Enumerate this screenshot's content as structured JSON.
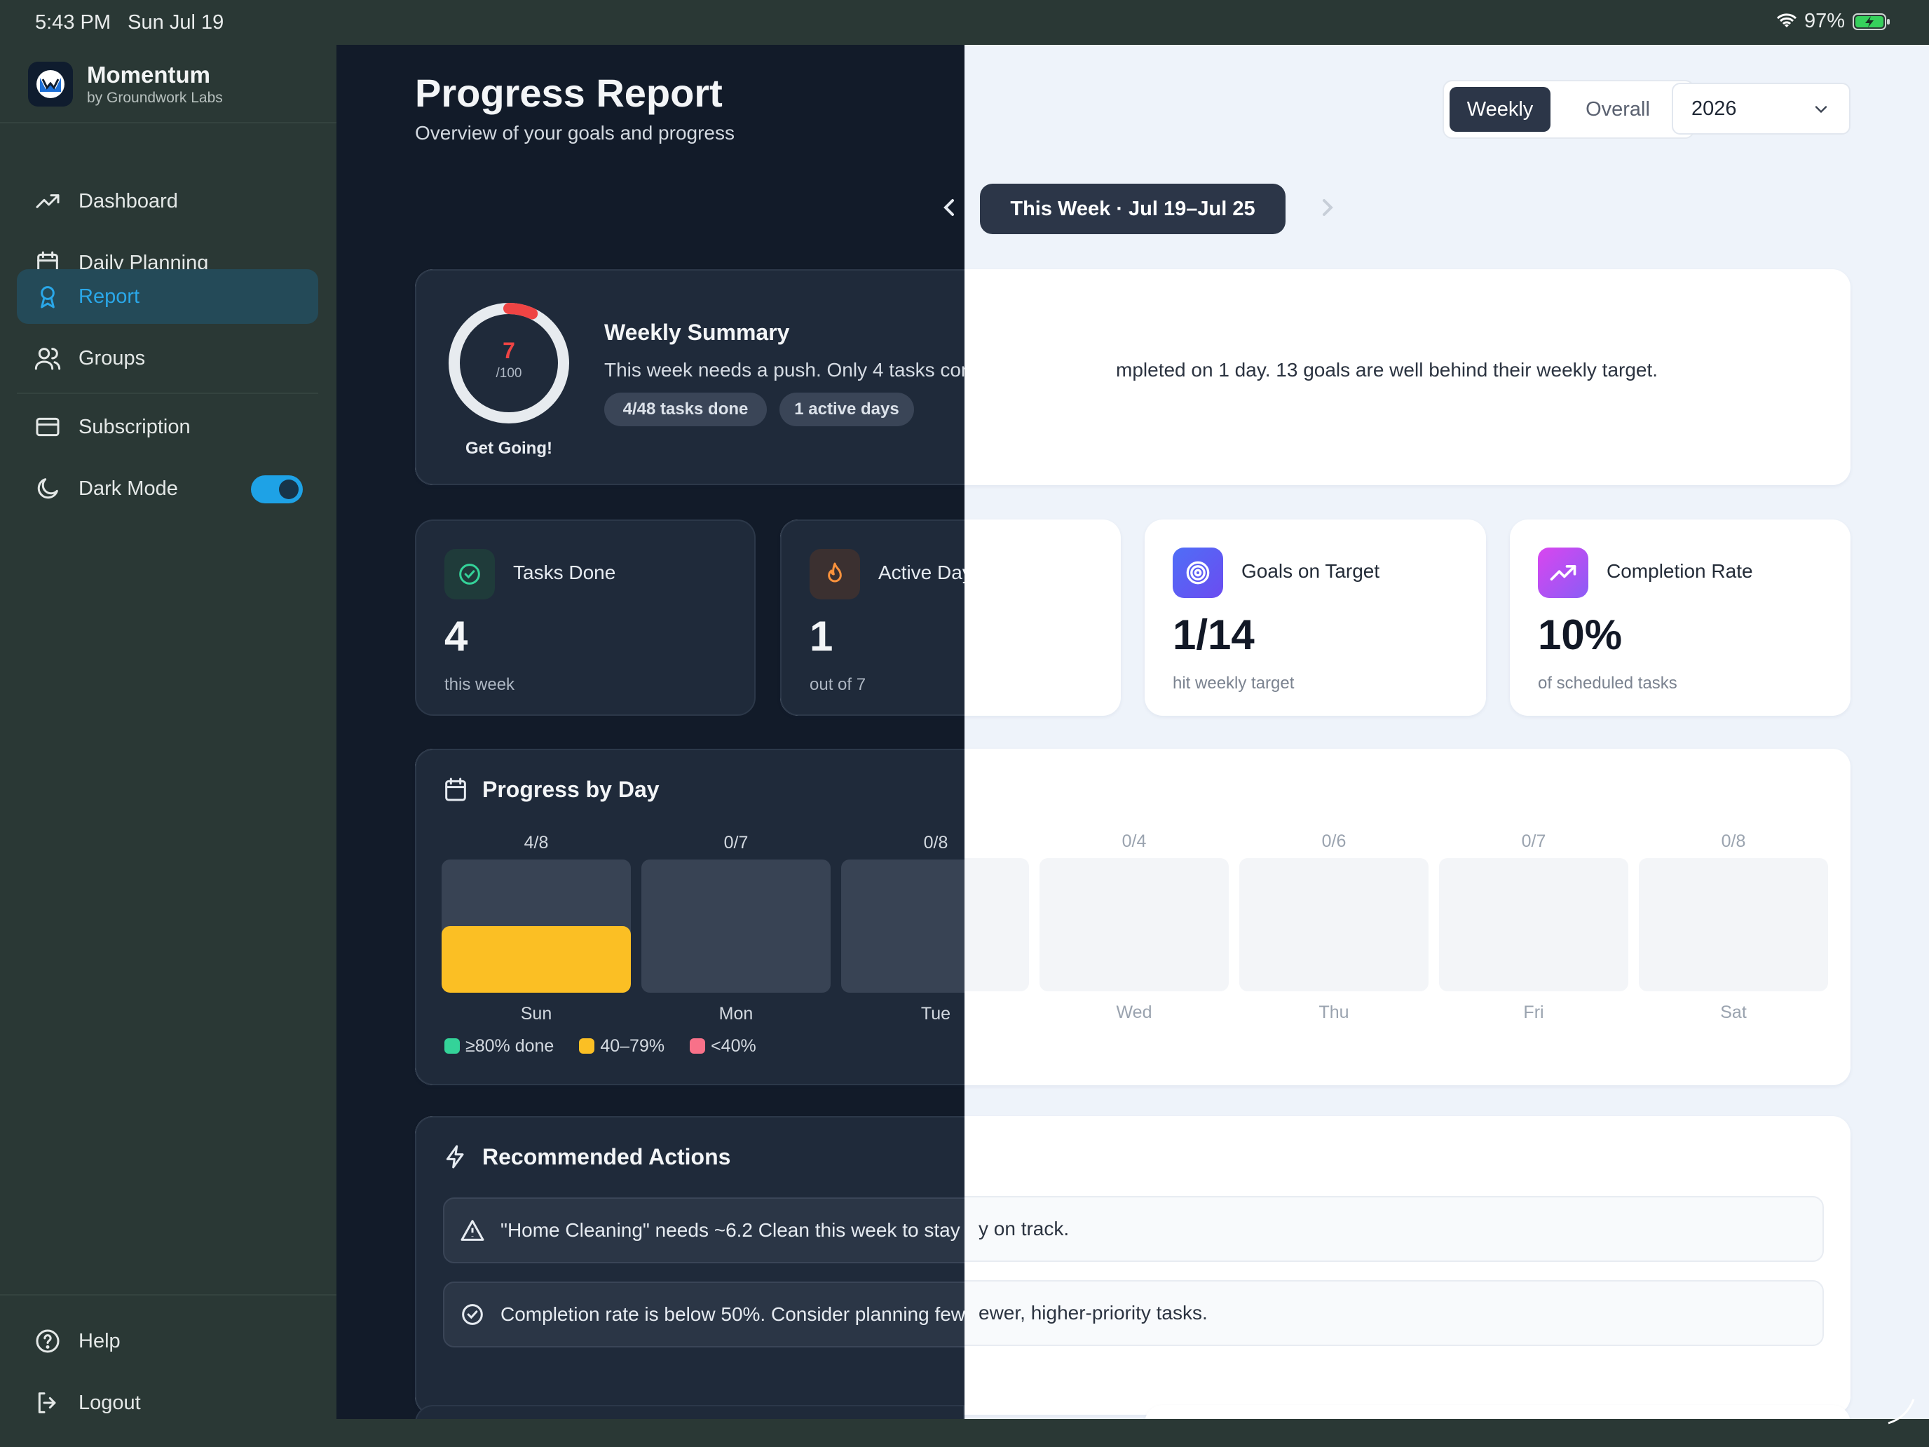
{
  "status_bar": {
    "time": "5:43 PM",
    "date": "Sun Jul 19",
    "battery": "97%"
  },
  "brand": {
    "name": "Momentum",
    "subtitle": "by Groundwork Labs"
  },
  "nav": {
    "dashboard": "Dashboard",
    "daily_planning": "Daily Planning",
    "report": "Report",
    "groups": "Groups",
    "subscription": "Subscription",
    "dark_mode": "Dark Mode",
    "dark_mode_on": true,
    "help": "Help",
    "logout": "Logout"
  },
  "header": {
    "title": "Progress Report",
    "subtitle": "Overview of your goals and progress",
    "segment_weekly": "Weekly",
    "segment_overall": "Overall",
    "year": "2026",
    "week_label": "This Week · Jul 19–Jul 25"
  },
  "summary": {
    "score": "7",
    "score_max": "/100",
    "score_fraction": 0.07,
    "score_label": "Get Going!",
    "title": "Weekly Summary",
    "text": "This week needs a push. Only 4 tasks completed on 1 day. 13 goals are well behind their weekly target.",
    "chip_tasks": "4/48 tasks done",
    "chip_days": "1 active days"
  },
  "stats": {
    "tasks_done": {
      "label": "Tasks Done",
      "value": "4",
      "sub": "this week"
    },
    "active_days": {
      "label": "Active Days",
      "value": "1",
      "sub": "out of 7"
    },
    "goals_on_target": {
      "label": "Goals on Target",
      "value": "1/14",
      "sub": "hit weekly target"
    },
    "completion_rate": {
      "label": "Completion Rate",
      "value": "10%",
      "sub": "of scheduled tasks"
    }
  },
  "progress_by_day": {
    "title": "Progress by Day",
    "days": [
      {
        "name": "Sun",
        "frac": "4/8",
        "done": 4,
        "total": 8
      },
      {
        "name": "Mon",
        "frac": "0/7",
        "done": 0,
        "total": 7
      },
      {
        "name": "Tue",
        "frac": "0/8",
        "done": 0,
        "total": 8
      },
      {
        "name": "Wed",
        "frac": "0/4",
        "done": 0,
        "total": 4
      },
      {
        "name": "Thu",
        "frac": "0/6",
        "done": 0,
        "total": 6
      },
      {
        "name": "Fri",
        "frac": "0/7",
        "done": 0,
        "total": 7
      },
      {
        "name": "Sat",
        "frac": "0/8",
        "done": 0,
        "total": 8
      }
    ],
    "legend": {
      "high": "≥80% done",
      "mid": "40–79%",
      "low": "<40%"
    },
    "colors": {
      "high": "#34d399",
      "mid": "#fbbf24",
      "low": "#f87189"
    }
  },
  "recommendations": {
    "title": "Recommended Actions",
    "items": [
      "\"Home Cleaning\" needs ~6.2 Clean this week to stay on track.",
      "Completion rate is below 50%. Consider planning fewer, higher-priority tasks."
    ]
  }
}
